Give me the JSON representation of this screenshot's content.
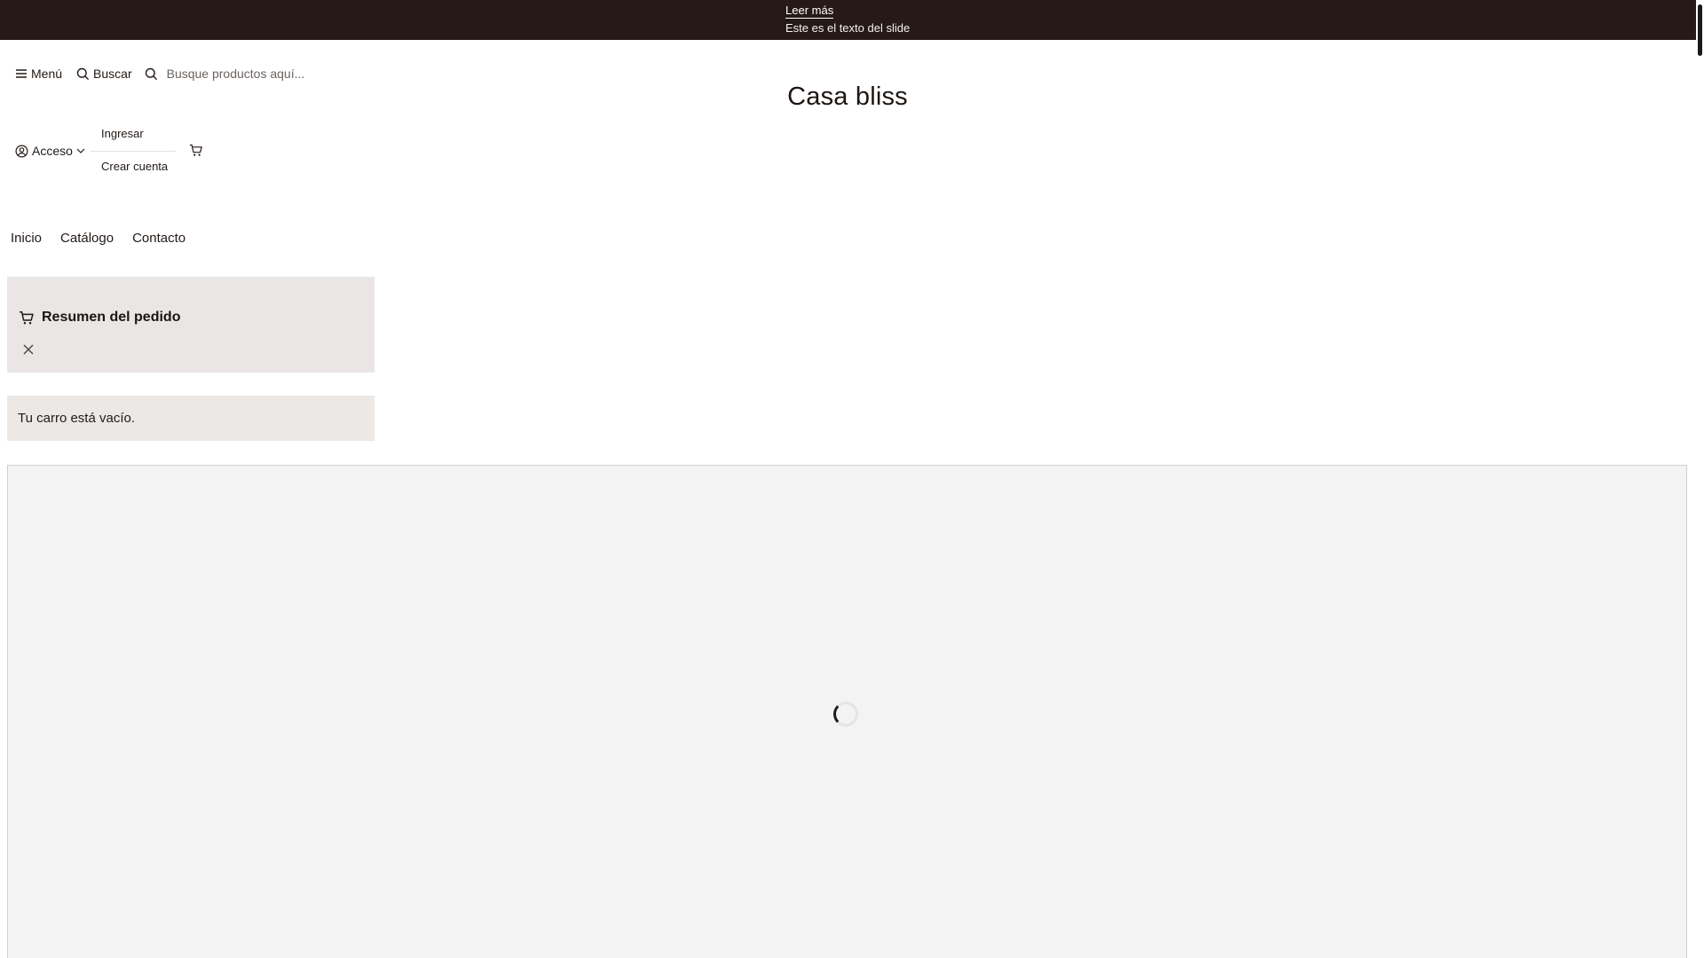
{
  "announcement": {
    "link_label": "Leer más",
    "slide_text": "Este es el texto del slide"
  },
  "header": {
    "menu_label": "Menú",
    "search_label": "Buscar",
    "search_placeholder": "Busque productos aquí...",
    "brand": "Casa bliss",
    "account_label": "Acceso",
    "account_menu": {
      "login": "Ingresar",
      "register": "Crear cuenta"
    }
  },
  "nav": {
    "items": [
      "Inicio",
      "Catálogo",
      "Contacto"
    ]
  },
  "cart": {
    "summary_title": "Resumen del pedido",
    "empty_message": "Tu carro está vacío."
  },
  "colors": {
    "announcement_bg": "#261a16",
    "panel_bg": "#e9e6e5",
    "frame_bg": "#f3f3f3"
  }
}
